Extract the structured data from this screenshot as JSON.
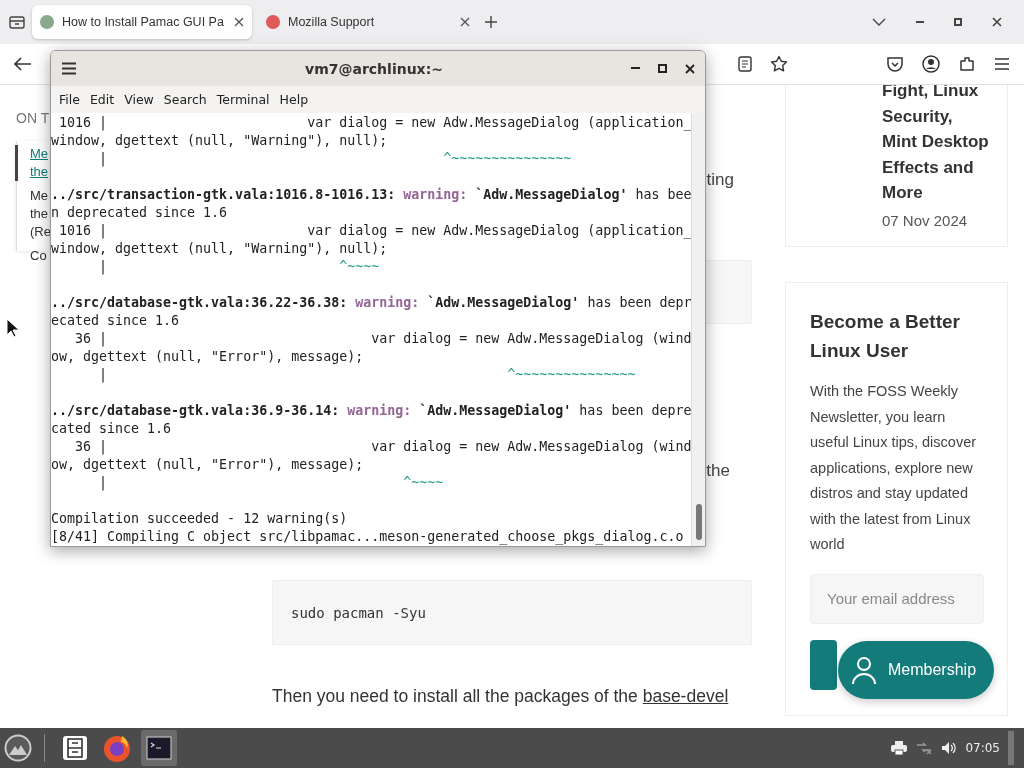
{
  "browser": {
    "tabs": [
      {
        "title": "How to Install Pamac GUI Pa",
        "selected": true
      },
      {
        "title": "Mozilla Support",
        "selected": false
      }
    ]
  },
  "page": {
    "toc": {
      "heading": "ON T",
      "items": [
        {
          "lines": [
            "Me",
            "the"
          ],
          "selected": true
        },
        {
          "lines": [
            "Me",
            "the",
            "(Re"
          ],
          "selected": false
        },
        {
          "lines": [
            "Co"
          ],
          "selected": false
        }
      ]
    },
    "article": {
      "fragments": [
        "ting",
        "the"
      ],
      "code": "sudo pacman -Syu",
      "paragraph": {
        "before": "Then you need to install all the packages of the ",
        "link": "base-devel"
      }
    },
    "post": {
      "title": "Fight, Linux Security, Mint Desktop Effects and More",
      "date": "07 Nov 2024"
    },
    "newsletter": {
      "heading": "Become a Better Linux User",
      "text": "With the FOSS Weekly Newsletter, you learn useful Linux tips, discover applications, explore new distros and stay updated with the latest from Linux world",
      "placeholder": "Your email address"
    },
    "membership_button": "Membership"
  },
  "terminal": {
    "title": "vm7@archlinux:~",
    "menu": [
      "File",
      "Edit",
      "View",
      "Search",
      "Terminal",
      "Help"
    ],
    "lines": [
      {
        "kind": "text",
        "spans": [
          {
            "kind": "plain",
            "text": " 1016 |                         var dialog = new Adw.MessageDialog (application_"
          }
        ]
      },
      {
        "kind": "text",
        "spans": [
          {
            "kind": "plain",
            "text": "window, dgettext (null, \"Warning\"), null);"
          }
        ]
      },
      {
        "kind": "text",
        "spans": [
          {
            "kind": "plain",
            "text": "      |                                          "
          },
          {
            "kind": "marker",
            "text": "^~~~~~~~~~~~~~~~"
          }
        ]
      },
      {
        "kind": "blank"
      },
      {
        "kind": "text",
        "spans": [
          {
            "kind": "bold",
            "text": "../src/transaction-gtk.vala:1016.8-1016.13: "
          },
          {
            "kind": "warning",
            "text": "warning:"
          },
          {
            "kind": "bold",
            "text": " `Adw.MessageDialog'"
          },
          {
            "kind": "plain",
            "text": " has bee"
          }
        ]
      },
      {
        "kind": "text",
        "spans": [
          {
            "kind": "plain",
            "text": "n deprecated since 1.6"
          }
        ]
      },
      {
        "kind": "text",
        "spans": [
          {
            "kind": "plain",
            "text": " 1016 |                         var dialog = new Adw.MessageDialog (application_"
          }
        ]
      },
      {
        "kind": "text",
        "spans": [
          {
            "kind": "plain",
            "text": "window, dgettext (null, \"Warning\"), null);"
          }
        ]
      },
      {
        "kind": "text",
        "spans": [
          {
            "kind": "plain",
            "text": "      |                             "
          },
          {
            "kind": "marker",
            "text": "^~~~~"
          }
        ]
      },
      {
        "kind": "blank"
      },
      {
        "kind": "text",
        "spans": [
          {
            "kind": "bold",
            "text": "../src/database-gtk.vala:36.22-36.38: "
          },
          {
            "kind": "warning",
            "text": "warning:"
          },
          {
            "kind": "bold",
            "text": " `Adw.MessageDialog'"
          },
          {
            "kind": "plain",
            "text": " has been depr"
          }
        ]
      },
      {
        "kind": "text",
        "spans": [
          {
            "kind": "plain",
            "text": "ecated since 1.6"
          }
        ]
      },
      {
        "kind": "text",
        "spans": [
          {
            "kind": "plain",
            "text": "   36 |                                 var dialog = new Adw.MessageDialog (wind"
          }
        ]
      },
      {
        "kind": "text",
        "spans": [
          {
            "kind": "plain",
            "text": "ow, dgettext (null, \"Error\"), message);"
          }
        ]
      },
      {
        "kind": "text",
        "spans": [
          {
            "kind": "plain",
            "text": "      |                                                  "
          },
          {
            "kind": "marker",
            "text": "^~~~~~~~~~~~~~~~"
          }
        ]
      },
      {
        "kind": "blank"
      },
      {
        "kind": "text",
        "spans": [
          {
            "kind": "bold",
            "text": "../src/database-gtk.vala:36.9-36.14: "
          },
          {
            "kind": "warning",
            "text": "warning:"
          },
          {
            "kind": "bold",
            "text": " `Adw.MessageDialog'"
          },
          {
            "kind": "plain",
            "text": " has been depre"
          }
        ]
      },
      {
        "kind": "text",
        "spans": [
          {
            "kind": "plain",
            "text": "cated since 1.6"
          }
        ]
      },
      {
        "kind": "text",
        "spans": [
          {
            "kind": "plain",
            "text": "   36 |                                 var dialog = new Adw.MessageDialog (wind"
          }
        ]
      },
      {
        "kind": "text",
        "spans": [
          {
            "kind": "plain",
            "text": "ow, dgettext (null, \"Error\"), message);"
          }
        ]
      },
      {
        "kind": "text",
        "spans": [
          {
            "kind": "plain",
            "text": "      |                                     "
          },
          {
            "kind": "marker",
            "text": "^~~~~"
          }
        ]
      },
      {
        "kind": "blank"
      },
      {
        "kind": "text",
        "spans": [
          {
            "kind": "plain",
            "text": "Compilation succeeded - 12 warning(s)"
          }
        ]
      },
      {
        "kind": "text",
        "spans": [
          {
            "kind": "plain",
            "text": "[8/41] Compiling C object src/libpamac...meson-generated_choose_pkgs_dialog.c.o"
          }
        ]
      }
    ]
  },
  "taskbar": {
    "apps": [
      {
        "kind": "files",
        "active": false
      },
      {
        "kind": "firefox",
        "active": false
      },
      {
        "kind": "terminal",
        "active": true
      }
    ],
    "clock": "07:05"
  }
}
